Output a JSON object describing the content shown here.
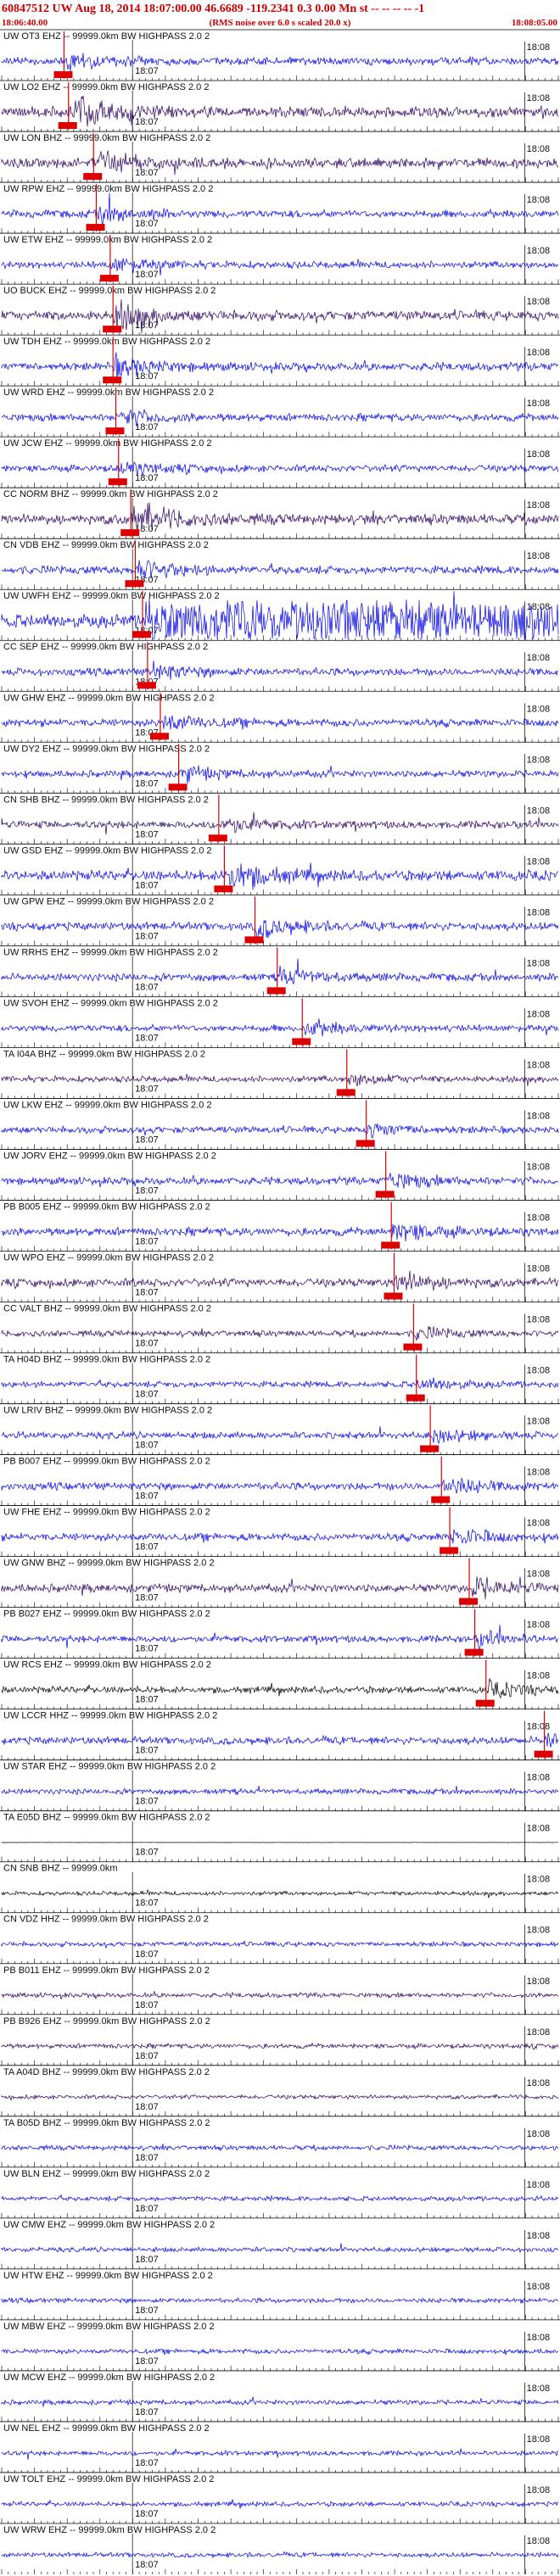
{
  "header": {
    "event_id": "60847512",
    "title": "60847512 UW Aug 18, 2014 18:07:00.00   46.6689 -119.2341  0.3 0.00 Mn st -- -- -- --   -1",
    "start_time": "18:06:40.00",
    "end_time": "18:08:05.00",
    "rms_note": "(RMS noise over 6.0 s scaled 20.0 x)"
  },
  "colors": {
    "header_text": "#cc0000",
    "trace_blue": "#0000e6",
    "trace_purple": "#2a0060",
    "trace_black": "#000000",
    "pick": "#dd0000",
    "tick": "#000000"
  },
  "chart_data": {
    "type": "seismogram",
    "time_ticks": [
      "18:07",
      "18:08"
    ],
    "traces": [
      {
        "label": "UW OT3 EHZ -- 99999.0km BW  HIGHPASS  2.0  2",
        "pick": 0.112,
        "color": "trace_blue",
        "amp": 0.55
      },
      {
        "label": "UW LO2 EHZ -- 99999.0km BW  HIGHPASS  2.0  2",
        "pick": 0.12,
        "color": "trace_purple",
        "amp": 0.75
      },
      {
        "label": "UW LON BHZ -- 99999.0km BW  HIGHPASS  2.0  2",
        "pick": 0.165,
        "color": "trace_purple",
        "amp": 0.7
      },
      {
        "label": "UW RPW EHZ -- 99999.0km BW  HIGHPASS  2.0  2",
        "pick": 0.17,
        "color": "trace_blue",
        "amp": 0.55
      },
      {
        "label": "UW ETW EHZ -- 99999.0km BW  HIGHPASS  2.0  2",
        "pick": 0.195,
        "color": "trace_blue",
        "amp": 0.5
      },
      {
        "label": "UO BUCK EHZ -- 99999.0km BW  HIGHPASS  2.0  2",
        "pick": 0.2,
        "color": "trace_purple",
        "amp": 0.7
      },
      {
        "label": "UW TDH EHZ -- 99999.0km BW  HIGHPASS  2.0  2",
        "pick": 0.2,
        "color": "trace_blue",
        "amp": 0.6
      },
      {
        "label": "UW WRD EHZ -- 99999.0km BW  HIGHPASS  2.0  2",
        "pick": 0.205,
        "color": "trace_blue",
        "amp": 0.55
      },
      {
        "label": "UW JCW EHZ -- 99999.0km BW  HIGHPASS  2.0  2",
        "pick": 0.21,
        "color": "trace_blue",
        "amp": 0.5
      },
      {
        "label": "CC NORM BHZ -- 99999.0km BW  HIGHPASS  2.0  2",
        "pick": 0.232,
        "color": "trace_purple",
        "amp": 0.75
      },
      {
        "label": "CN VDB EHZ -- 99999.0km BW  HIGHPASS  2.0  2",
        "pick": 0.24,
        "color": "trace_blue",
        "amp": 0.6
      },
      {
        "label": "UW UWFH EHZ -- 99999.0km BW  HIGHPASS  2.0  2",
        "pick": 0.253,
        "color": "trace_blue",
        "amp": 1.0
      },
      {
        "label": "CC SEP EHZ -- 99999.0km BW  HIGHPASS  2.0  2",
        "pick": 0.262,
        "color": "trace_blue",
        "amp": 0.55
      },
      {
        "label": "UW GHW EHZ -- 99999.0km BW  HIGHPASS  2.0  2",
        "pick": 0.285,
        "color": "trace_blue",
        "amp": 0.55
      },
      {
        "label": "UW DY2 EHZ -- 99999.0km BW  HIGHPASS  2.0  2",
        "pick": 0.318,
        "color": "trace_blue",
        "amp": 0.5
      },
      {
        "label": "CN SHB BHZ -- 99999.0km BW  HIGHPASS  2.0  2",
        "pick": 0.39,
        "color": "trace_purple",
        "amp": 0.55
      },
      {
        "label": "UW GSD EHZ -- 99999.0km BW  HIGHPASS  2.0  2",
        "pick": 0.4,
        "color": "trace_blue",
        "amp": 0.75
      },
      {
        "label": "UW GPW EHZ -- 99999.0km BW  HIGHPASS  2.0  2",
        "pick": 0.455,
        "color": "trace_blue",
        "amp": 0.6
      },
      {
        "label": "UW RRHS EHZ -- 99999.0km BW  HIGHPASS  2.0  2",
        "pick": 0.495,
        "color": "trace_blue",
        "amp": 0.55
      },
      {
        "label": "UW SVOH EHZ -- 99999.0km BW  HIGHPASS  2.0  2",
        "pick": 0.54,
        "color": "trace_blue",
        "amp": 0.5
      },
      {
        "label": "TA I04A BHZ -- 99999.0km BW  HIGHPASS  2.0  2",
        "pick": 0.62,
        "color": "trace_purple",
        "amp": 0.45
      },
      {
        "label": "UW LKW EHZ -- 99999.0km BW  HIGHPASS  2.0  2",
        "pick": 0.655,
        "color": "trace_blue",
        "amp": 0.5
      },
      {
        "label": "UW JORV EHZ -- 99999.0km BW  HIGHPASS  2.0  2",
        "pick": 0.69,
        "color": "trace_blue",
        "amp": 0.55
      },
      {
        "label": "PB B005 EHZ -- 99999.0km BW  HIGHPASS  2.0  2",
        "pick": 0.7,
        "color": "trace_blue",
        "amp": 0.6
      },
      {
        "label": "UW WPO EHZ -- 99999.0km BW  HIGHPASS  2.0  2",
        "pick": 0.705,
        "color": "trace_purple",
        "amp": 0.6
      },
      {
        "label": "CC VALT BHZ -- 99999.0km BW  HIGHPASS  2.0  2",
        "pick": 0.74,
        "color": "trace_purple",
        "amp": 0.45
      },
      {
        "label": "TA H04D BHZ -- 99999.0km BW  HIGHPASS  2.0  2",
        "pick": 0.745,
        "color": "trace_blue",
        "amp": 0.45
      },
      {
        "label": "UW LRIV BHZ -- 99999.0km BW  HIGHPASS  2.0  2",
        "pick": 0.77,
        "color": "trace_blue",
        "amp": 0.5
      },
      {
        "label": "PB B007 EHZ -- 99999.0km BW  HIGHPASS  2.0  2",
        "pick": 0.79,
        "color": "trace_blue",
        "amp": 0.55
      },
      {
        "label": "UW FHE EHZ -- 99999.0km BW  HIGHPASS  2.0  2",
        "pick": 0.805,
        "color": "trace_blue",
        "amp": 0.55
      },
      {
        "label": "UW GNW BHZ -- 99999.0km BW  HIGHPASS  2.0  2",
        "pick": 0.84,
        "color": "trace_purple",
        "amp": 0.6
      },
      {
        "label": "PB B027 EHZ -- 99999.0km BW  HIGHPASS  2.0  2",
        "pick": 0.85,
        "color": "trace_blue",
        "amp": 0.5
      },
      {
        "label": "UW RCS EHZ -- 99999.0km BW  HIGHPASS  2.0  2",
        "pick": 0.87,
        "color": "trace_black",
        "amp": 0.5
      },
      {
        "label": "UW LCCR HHZ -- 99999.0km BW  HIGHPASS  2.0  2",
        "pick": 0.975,
        "color": "trace_blue",
        "amp": 0.55
      },
      {
        "label": "UW STAR EHZ -- 99999.0km BW  HIGHPASS  2.0  2",
        "pick": null,
        "color": "trace_blue",
        "amp": 0.4
      },
      {
        "label": "TA E05D BHZ -- 99999.0km BW  HIGHPASS  2.0  2",
        "pick": null,
        "color": "trace_black",
        "amp": 0.02
      },
      {
        "label": "CN SNB BHZ -- 99999.0km",
        "pick": null,
        "color": "trace_black",
        "amp": 0.3
      },
      {
        "label": "CN VDZ HHZ -- 99999.0km BW  HIGHPASS  2.0  2",
        "pick": null,
        "color": "trace_blue",
        "amp": 0.35
      },
      {
        "label": "PB B011 EHZ -- 99999.0km BW  HIGHPASS  2.0  2",
        "pick": null,
        "color": "trace_purple",
        "amp": 0.35
      },
      {
        "label": "PB B926 EHZ -- 99999.0km BW  HIGHPASS  2.0  2",
        "pick": null,
        "color": "trace_purple",
        "amp": 0.35
      },
      {
        "label": "TA A04D BHZ -- 99999.0km BW  HIGHPASS  2.0  2",
        "pick": null,
        "color": "trace_purple",
        "amp": 0.3
      },
      {
        "label": "TA B05D BHZ -- 99999.0km BW  HIGHPASS  2.0  2",
        "pick": null,
        "color": "trace_blue",
        "amp": 0.35
      },
      {
        "label": "UW BLN EHZ -- 99999.0km BW  HIGHPASS  2.0  2",
        "pick": null,
        "color": "trace_blue",
        "amp": 0.35
      },
      {
        "label": "UW CMW EHZ -- 99999.0km BW  HIGHPASS  2.0  2",
        "pick": null,
        "color": "trace_blue",
        "amp": 0.35
      },
      {
        "label": "UW HTW EHZ -- 99999.0km BW  HIGHPASS  2.0  2",
        "pick": null,
        "color": "trace_blue",
        "amp": 0.35
      },
      {
        "label": "UW MBW EHZ -- 99999.0km BW  HIGHPASS  2.0  2",
        "pick": null,
        "color": "trace_blue",
        "amp": 0.35
      },
      {
        "label": "UW MCW EHZ -- 99999.0km BW  HIGHPASS  2.0  2",
        "pick": null,
        "color": "trace_blue",
        "amp": 0.35
      },
      {
        "label": "UW NEL EHZ -- 99999.0km BW  HIGHPASS  2.0  2",
        "pick": null,
        "color": "trace_blue",
        "amp": 0.35
      },
      {
        "label": "UW TOLT EHZ -- 99999.0km BW  HIGHPASS  2.0  2",
        "pick": null,
        "color": "trace_blue",
        "amp": 0.35
      },
      {
        "label": "UW WRW EHZ -- 99999.0km BW  HIGHPASS  2.0  2",
        "pick": null,
        "color": "trace_blue",
        "amp": 0.35
      }
    ]
  }
}
